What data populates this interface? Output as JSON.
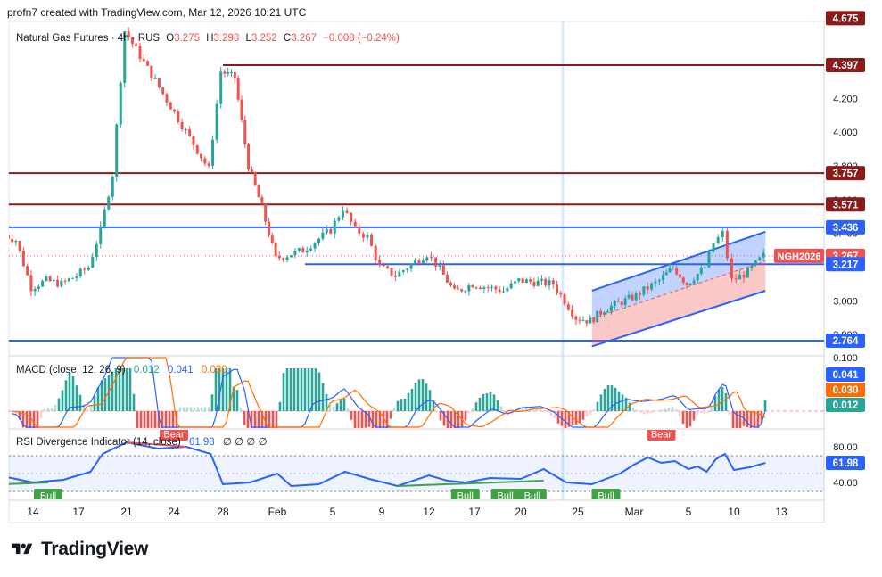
{
  "header": {
    "attribution": "profn7 created with TradingView.com, Mar 12, 2026 10:21 UTC"
  },
  "brand": {
    "name": "TradingView"
  },
  "chart_data": {
    "type": "candlestick",
    "title": "Natural Gas Futures · 4h · RUS",
    "ohlc_label": {
      "O": "3.275",
      "H": "3.298",
      "L": "3.252",
      "C": "3.267",
      "change": "−0.008 (−0.24%)"
    },
    "symbol_tag": "NGH2026",
    "last_price": 3.267,
    "colors": {
      "up": "#26a69a",
      "down": "#ef5350",
      "support": "#2962ff",
      "resistance": "#8b1a1a",
      "axis_text": "#131722"
    },
    "price_axis": {
      "ticks": [
        "4.200",
        "4.000",
        "3.800",
        "3.600",
        "3.400",
        "3.000",
        "2.800"
      ],
      "labels": [
        {
          "text": "4.675",
          "value": 4.675,
          "color": "#8b1a1a"
        },
        {
          "text": "4.397",
          "value": 4.397,
          "color": "#8b1a1a"
        },
        {
          "text": "3.757",
          "value": 3.757,
          "color": "#8b1a1a"
        },
        {
          "text": "3.571",
          "value": 3.571,
          "color": "#8b1a1a"
        },
        {
          "text": "3.436",
          "value": 3.436,
          "color": "#2962ff"
        },
        {
          "text": "3.267",
          "value": 3.267,
          "color": "#ef5350"
        },
        {
          "text": "3.217",
          "value": 3.217,
          "color": "#2962ff"
        },
        {
          "text": "2.764",
          "value": 2.764,
          "color": "#2962ff"
        }
      ],
      "ylim": [
        2.73,
        4.71
      ]
    },
    "levels": [
      {
        "value": 4.397,
        "color": "#8b1a1a",
        "from": "Jan 28"
      },
      {
        "value": 3.757,
        "color": "#8b1a1a",
        "from": "Jan 12"
      },
      {
        "value": 3.571,
        "color": "#8b1a1a",
        "from": "Jan 12"
      },
      {
        "value": 3.436,
        "color": "#2962ff",
        "from": "Jan 12"
      },
      {
        "value": 3.217,
        "color": "#2962ff",
        "from": "Feb 3"
      },
      {
        "value": 2.764,
        "color": "#2962ff",
        "from": "Jan 12"
      }
    ],
    "channel": {
      "upper": [
        {
          "date": "Feb 26",
          "value": 3.06
        },
        {
          "date": "Mar 12",
          "value": 3.41
        }
      ],
      "lower": [
        {
          "date": "Feb 26",
          "value": 2.73
        },
        {
          "date": "Mar 12",
          "value": 3.06
        }
      ]
    },
    "x_axis": {
      "ticks": [
        "14",
        "17",
        "21",
        "24",
        "28",
        "Feb",
        "5",
        "9",
        "12",
        "17",
        "20",
        "25",
        "Mar",
        "5",
        "10",
        "13"
      ]
    },
    "price_series": [
      {
        "date": "Jan 12",
        "close": 3.4
      },
      {
        "date": "Jan 13",
        "close": 3.36
      },
      {
        "date": "Jan 14",
        "close": 3.08
      },
      {
        "date": "Jan 15",
        "close": 3.12
      },
      {
        "date": "Jan 16",
        "close": 3.1
      },
      {
        "date": "Jan 17",
        "close": 3.15
      },
      {
        "date": "Jan 18",
        "close": 3.2
      },
      {
        "date": "Jan 19",
        "close": 3.42
      },
      {
        "date": "Jan 20",
        "close": 3.75
      },
      {
        "date": "Jan 21",
        "close": 4.6
      },
      {
        "date": "Jan 27",
        "close": 3.78
      },
      {
        "date": "Jan 28",
        "close": 4.36
      },
      {
        "date": "Jan 29",
        "close": 4.32
      },
      {
        "date": "Jan 30",
        "close": 3.8
      },
      {
        "date": "Jan 31",
        "close": 3.55
      },
      {
        "date": "Feb 1",
        "close": 3.25
      },
      {
        "date": "Feb 3",
        "close": 3.3
      },
      {
        "date": "Feb 5",
        "close": 3.42
      },
      {
        "date": "Feb 6",
        "close": 3.55
      },
      {
        "date": "Feb 7",
        "close": 3.42
      },
      {
        "date": "Feb 8",
        "close": 3.38
      },
      {
        "date": "Feb 9",
        "close": 3.2
      },
      {
        "date": "Feb 10",
        "close": 3.15
      },
      {
        "date": "Feb 12",
        "close": 3.28
      },
      {
        "date": "Feb 13",
        "close": 3.22
      },
      {
        "date": "Feb 15",
        "close": 3.05
      },
      {
        "date": "Feb 17",
        "close": 3.1
      },
      {
        "date": "Feb 19",
        "close": 3.06
      },
      {
        "date": "Feb 20",
        "close": 3.12
      },
      {
        "date": "Feb 23",
        "close": 3.1
      },
      {
        "date": "Feb 25",
        "close": 2.9
      },
      {
        "date": "Feb 26",
        "close": 2.88
      },
      {
        "date": "Feb 27",
        "close": 2.95
      },
      {
        "date": "Mar 1",
        "close": 3.02
      },
      {
        "date": "Mar 3",
        "close": 3.12
      },
      {
        "date": "Mar 4",
        "close": 3.2
      },
      {
        "date": "Mar 5",
        "close": 3.1
      },
      {
        "date": "Mar 7",
        "close": 3.2
      },
      {
        "date": "Mar 8",
        "close": 3.34
      },
      {
        "date": "Mar 9",
        "close": 3.4
      },
      {
        "date": "Mar 10",
        "close": 3.12
      },
      {
        "date": "Mar 11",
        "close": 3.17
      },
      {
        "date": "Mar 12",
        "close": 3.267
      }
    ],
    "macd": {
      "label": "MACD (close, 12, 26, 9)",
      "histogram": 0.012,
      "macd": 0.041,
      "signal": 0.03,
      "value_labels": [
        {
          "text": "0.041",
          "color": "#2962ff"
        },
        {
          "text": "0.030",
          "color": "#ff6d00"
        },
        {
          "text": "0.012",
          "color": "#26a69a"
        }
      ],
      "scale_label": "0.100"
    },
    "rsi": {
      "label": "RSI Divergence Indicator (14, close)",
      "value": 61.98,
      "value_text": "61.98",
      "extra": "∅ ∅ ∅ ∅",
      "ticks": [
        "80.00",
        "40.00"
      ],
      "ylim": [
        20,
        100
      ],
      "series": [
        {
          "date": "Jan 12",
          "v": 47
        },
        {
          "date": "Jan 14",
          "v": 40
        },
        {
          "date": "Jan 16",
          "v": 43
        },
        {
          "date": "Jan 18",
          "v": 52
        },
        {
          "date": "Jan 19",
          "v": 72
        },
        {
          "date": "Jan 21",
          "v": 85
        },
        {
          "date": "Jan 23",
          "v": 78
        },
        {
          "date": "Jan 25",
          "v": 80
        },
        {
          "date": "Jan 27",
          "v": 72
        },
        {
          "date": "Jan 28",
          "v": 38
        },
        {
          "date": "Jan 30",
          "v": 40
        },
        {
          "date": "Feb 1",
          "v": 50
        },
        {
          "date": "Feb 2",
          "v": 36
        },
        {
          "date": "Feb 4",
          "v": 38
        },
        {
          "date": "Feb 6",
          "v": 52
        },
        {
          "date": "Feb 8",
          "v": 44
        },
        {
          "date": "Feb 10",
          "v": 36
        },
        {
          "date": "Feb 12",
          "v": 48
        },
        {
          "date": "Feb 14",
          "v": 42
        },
        {
          "date": "Feb 16",
          "v": 40
        },
        {
          "date": "Feb 18",
          "v": 45
        },
        {
          "date": "Feb 20",
          "v": 44
        },
        {
          "date": "Feb 22",
          "v": 55
        },
        {
          "date": "Feb 24",
          "v": 40
        },
        {
          "date": "Feb 26",
          "v": 38
        },
        {
          "date": "Feb 28",
          "v": 50
        },
        {
          "date": "Mar 1",
          "v": 60
        },
        {
          "date": "Mar 2",
          "v": 68
        },
        {
          "date": "Mar 3",
          "v": 62
        },
        {
          "date": "Mar 4",
          "v": 64
        },
        {
          "date": "Mar 5",
          "v": 55
        },
        {
          "date": "Mar 6",
          "v": 58
        },
        {
          "date": "Mar 7",
          "v": 52
        },
        {
          "date": "Mar 8",
          "v": 66
        },
        {
          "date": "Mar 9",
          "v": 72
        },
        {
          "date": "Mar 10",
          "v": 54
        },
        {
          "date": "Mar 11",
          "v": 57
        },
        {
          "date": "Mar 12",
          "v": 61.98
        }
      ],
      "markers": [
        {
          "label": "Bear",
          "date": "Jan 24",
          "kind": "bear"
        },
        {
          "label": "Bear",
          "date": "Mar 3",
          "kind": "bear"
        },
        {
          "label": "Bull",
          "date": "Jan 15",
          "kind": "bull"
        },
        {
          "label": "Bull",
          "date": "Feb 16",
          "kind": "bull"
        },
        {
          "label": "Bull",
          "date": "Feb 19",
          "kind": "bull"
        },
        {
          "label": "Bull",
          "date": "Feb 21",
          "kind": "bull"
        },
        {
          "label": "Bull",
          "date": "Feb 27",
          "kind": "bull"
        }
      ]
    }
  }
}
